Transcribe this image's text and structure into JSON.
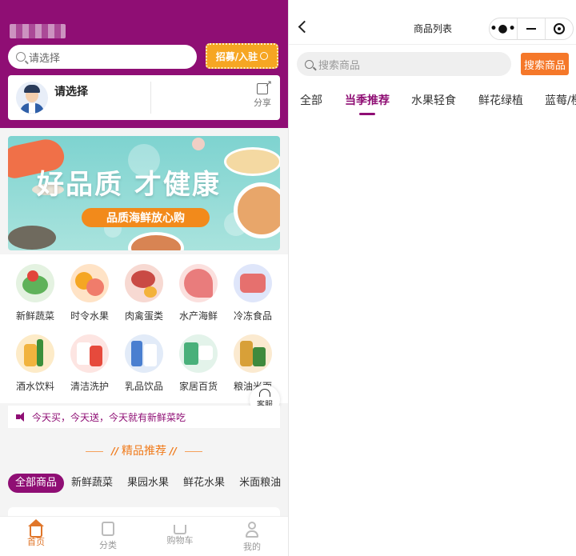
{
  "home": {
    "search_placeholder": "请选择",
    "recruit_label": "招募/入驻",
    "store": {
      "name": "请选择",
      "share_label": "分享"
    },
    "banner": {
      "headline": "好品质 才健康",
      "tagline": "品质海鲜放心购"
    },
    "categories": [
      {
        "label": "新鲜蔬菜",
        "icon": "vegetables-icon",
        "color": "#5fb25a"
      },
      {
        "label": "时令水果",
        "icon": "fruit-icon",
        "color": "#f3a23a"
      },
      {
        "label": "肉禽蛋类",
        "icon": "meat-icon",
        "color": "#d9574d"
      },
      {
        "label": "水产海鲜",
        "icon": "seafood-icon",
        "color": "#e97c7c"
      },
      {
        "label": "冷冻食品",
        "icon": "frozen-food-icon",
        "color": "#e6706e"
      },
      {
        "label": "酒水饮料",
        "icon": "beverage-icon",
        "color": "#f1b33e"
      },
      {
        "label": "清洁洗护",
        "icon": "cleaning-icon",
        "color": "#e64a3c"
      },
      {
        "label": "乳品饮品",
        "icon": "dairy-icon",
        "color": "#4a7fd0"
      },
      {
        "label": "家居百货",
        "icon": "household-icon",
        "color": "#49b07a"
      },
      {
        "label": "粮油米面",
        "icon": "grain-oil-icon",
        "color": "#d8a038"
      }
    ],
    "service_label": "客服",
    "notice": "今天买，今天送，今天就有新鲜菜吃",
    "section_title": "精品推荐",
    "chips": [
      "全部商品",
      "新鲜蔬菜",
      "果园水果",
      "鲜花水果",
      "米面粮油"
    ],
    "tabbar": [
      {
        "label": "首页",
        "icon": "home-icon"
      },
      {
        "label": "分类",
        "icon": "category-icon"
      },
      {
        "label": "购物车",
        "icon": "cart-icon"
      },
      {
        "label": "我的",
        "icon": "profile-icon"
      }
    ],
    "colors": {
      "brand": "#8f0e74",
      "accent": "#f5782a",
      "recruit": "#f6a623"
    }
  },
  "list": {
    "title": "商品列表",
    "capsule": {
      "more": "•●•"
    },
    "search_placeholder": "搜索商品",
    "search_button": "搜索商品",
    "tabs": [
      "全部",
      "当季推荐",
      "水果轻食",
      "鲜花绿植",
      "蓝莓/樱"
    ]
  }
}
